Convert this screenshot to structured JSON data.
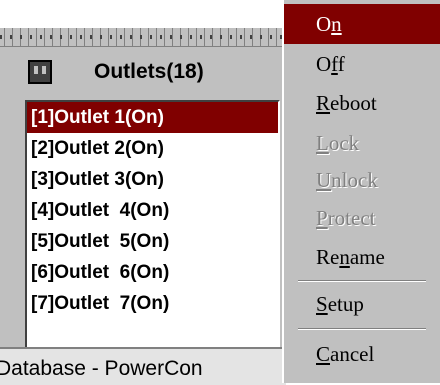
{
  "panel": {
    "title": "Outlets(18)",
    "status_text": "Database - PowerCon"
  },
  "outlets": [
    {
      "label": "[1]Outlet 1(On)",
      "selected": true
    },
    {
      "label": "[2]Outlet 2(On)",
      "selected": false
    },
    {
      "label": "[3]Outlet 3(On)",
      "selected": false
    },
    {
      "label": "[4]Outlet  4(On)",
      "selected": false
    },
    {
      "label": "[5]Outlet  5(On)",
      "selected": false
    },
    {
      "label": "[6]Outlet  6(On)",
      "selected": false
    },
    {
      "label": "[7]Outlet  7(On)",
      "selected": false
    }
  ],
  "menu": {
    "items": [
      {
        "label": "On",
        "accel": "n",
        "state": "selected"
      },
      {
        "label": "Off",
        "accel": "f",
        "state": "normal"
      },
      {
        "label": "Reboot",
        "accel": "R",
        "state": "normal"
      },
      {
        "label": "Lock",
        "accel": "L",
        "state": "disabled"
      },
      {
        "label": "Unlock",
        "accel": "U",
        "state": "disabled"
      },
      {
        "label": "Protect",
        "accel": "P",
        "state": "disabled"
      },
      {
        "label": "Rename",
        "accel": "n",
        "state": "normal"
      },
      {
        "label": "Setup",
        "accel": "S",
        "state": "normal"
      },
      {
        "label": "Cancel",
        "accel": "C",
        "state": "normal"
      }
    ]
  },
  "colors": {
    "selection": "#800000",
    "panel_bg": "#c0c0c0",
    "disabled_text": "#808080"
  }
}
